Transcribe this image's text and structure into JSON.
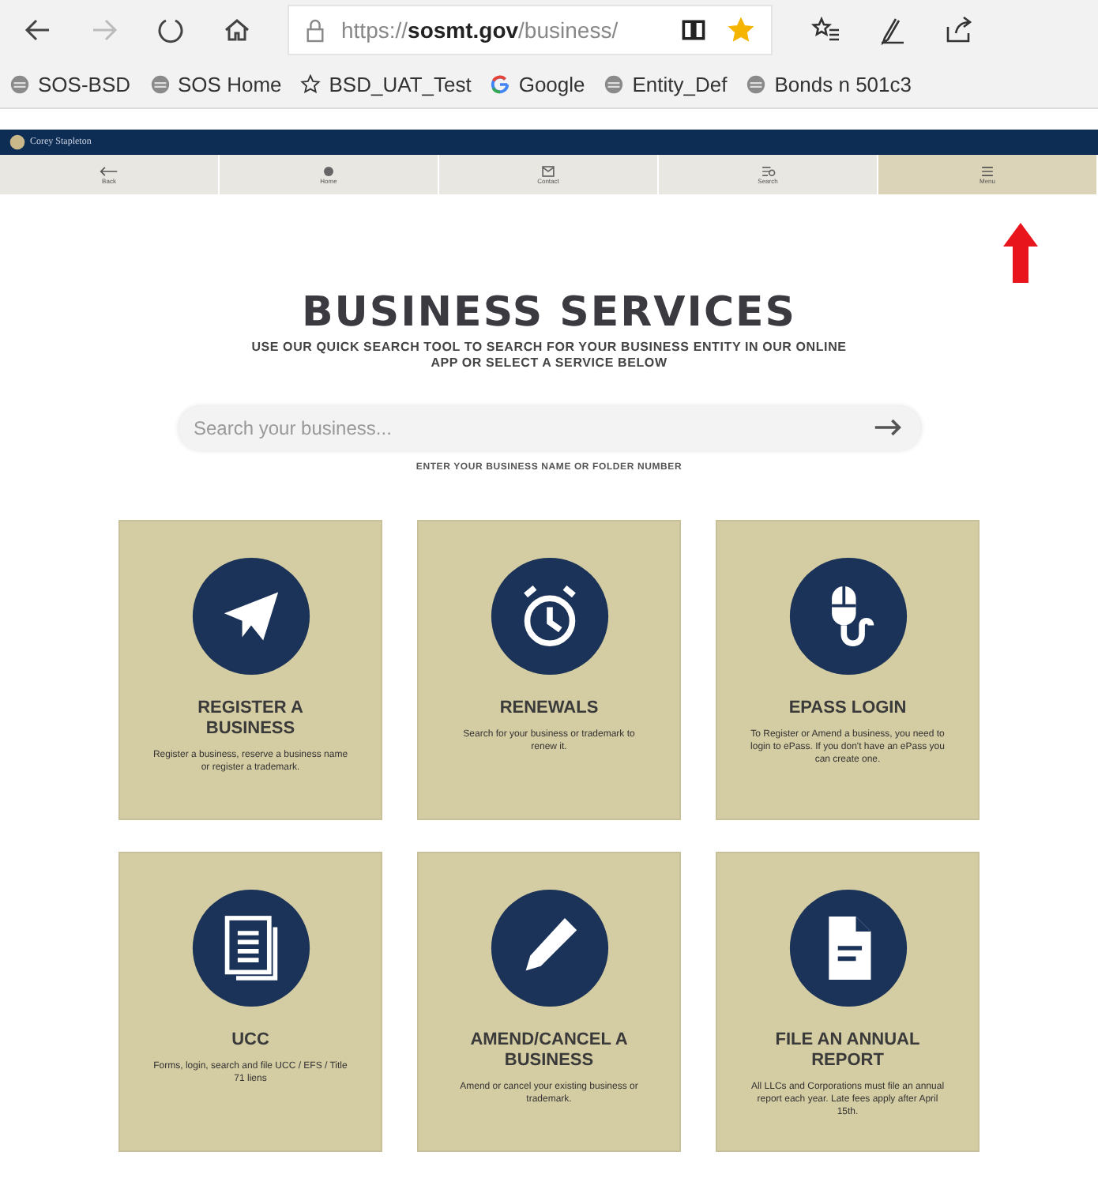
{
  "browser": {
    "url_prefix": "https://",
    "url_host": "sosmt.gov",
    "url_path": "/business/",
    "favorite": true
  },
  "bookmarks": [
    {
      "label": "SOS-BSD",
      "kind": "site"
    },
    {
      "label": "SOS Home",
      "kind": "site"
    },
    {
      "label": "BSD_UAT_Test",
      "kind": "star"
    },
    {
      "label": "Google",
      "kind": "google"
    },
    {
      "label": "Entity_Def",
      "kind": "site"
    },
    {
      "label": "Bonds n 501c3",
      "kind": "site"
    }
  ],
  "header": {
    "logo_text": "Corey Stapleton"
  },
  "nav": [
    {
      "label": "Back",
      "kind": "back",
      "selected": false
    },
    {
      "label": "Home",
      "kind": "home",
      "selected": false
    },
    {
      "label": "Contact",
      "kind": "contact",
      "selected": false
    },
    {
      "label": "Search",
      "kind": "search",
      "selected": false
    },
    {
      "label": "Menu",
      "kind": "menu",
      "selected": true
    }
  ],
  "page": {
    "title": "BUSINESS SERVICES",
    "subtitle": "USE OUR QUICK SEARCH TOOL TO SEARCH FOR YOUR BUSINESS ENTITY IN OUR ONLINE APP OR SELECT A SERVICE BELOW",
    "search": {
      "placeholder": "Search your business..."
    },
    "hint": "ENTER YOUR BUSINESS NAME OR FOLDER NUMBER"
  },
  "services": [
    {
      "title": "REGISTER A BUSINESS",
      "text": "Register a business, reserve a business name or register a trademark.",
      "kind": "plane"
    },
    {
      "title": "RENEWALS",
      "text": "Search for your business or trademark to renew it.",
      "kind": "clock"
    },
    {
      "title": "EPASS LOGIN",
      "text": "To Register or Amend a business, you need to login to ePass. If you don't have an ePass you can create one.",
      "kind": "mouse"
    },
    {
      "title": "UCC",
      "text": "Forms, login, search and file UCC / EFS / Title 71 liens",
      "kind": "docs"
    },
    {
      "title": "AMEND/CANCEL A BUSINESS",
      "text": "Amend or cancel your existing business or trademark.",
      "kind": "pencil"
    },
    {
      "title": "FILE AN ANNUAL REPORT",
      "text": "All LLCs and Corporations must file an annual report each year. Late fees apply after April 15th.",
      "kind": "file"
    }
  ]
}
